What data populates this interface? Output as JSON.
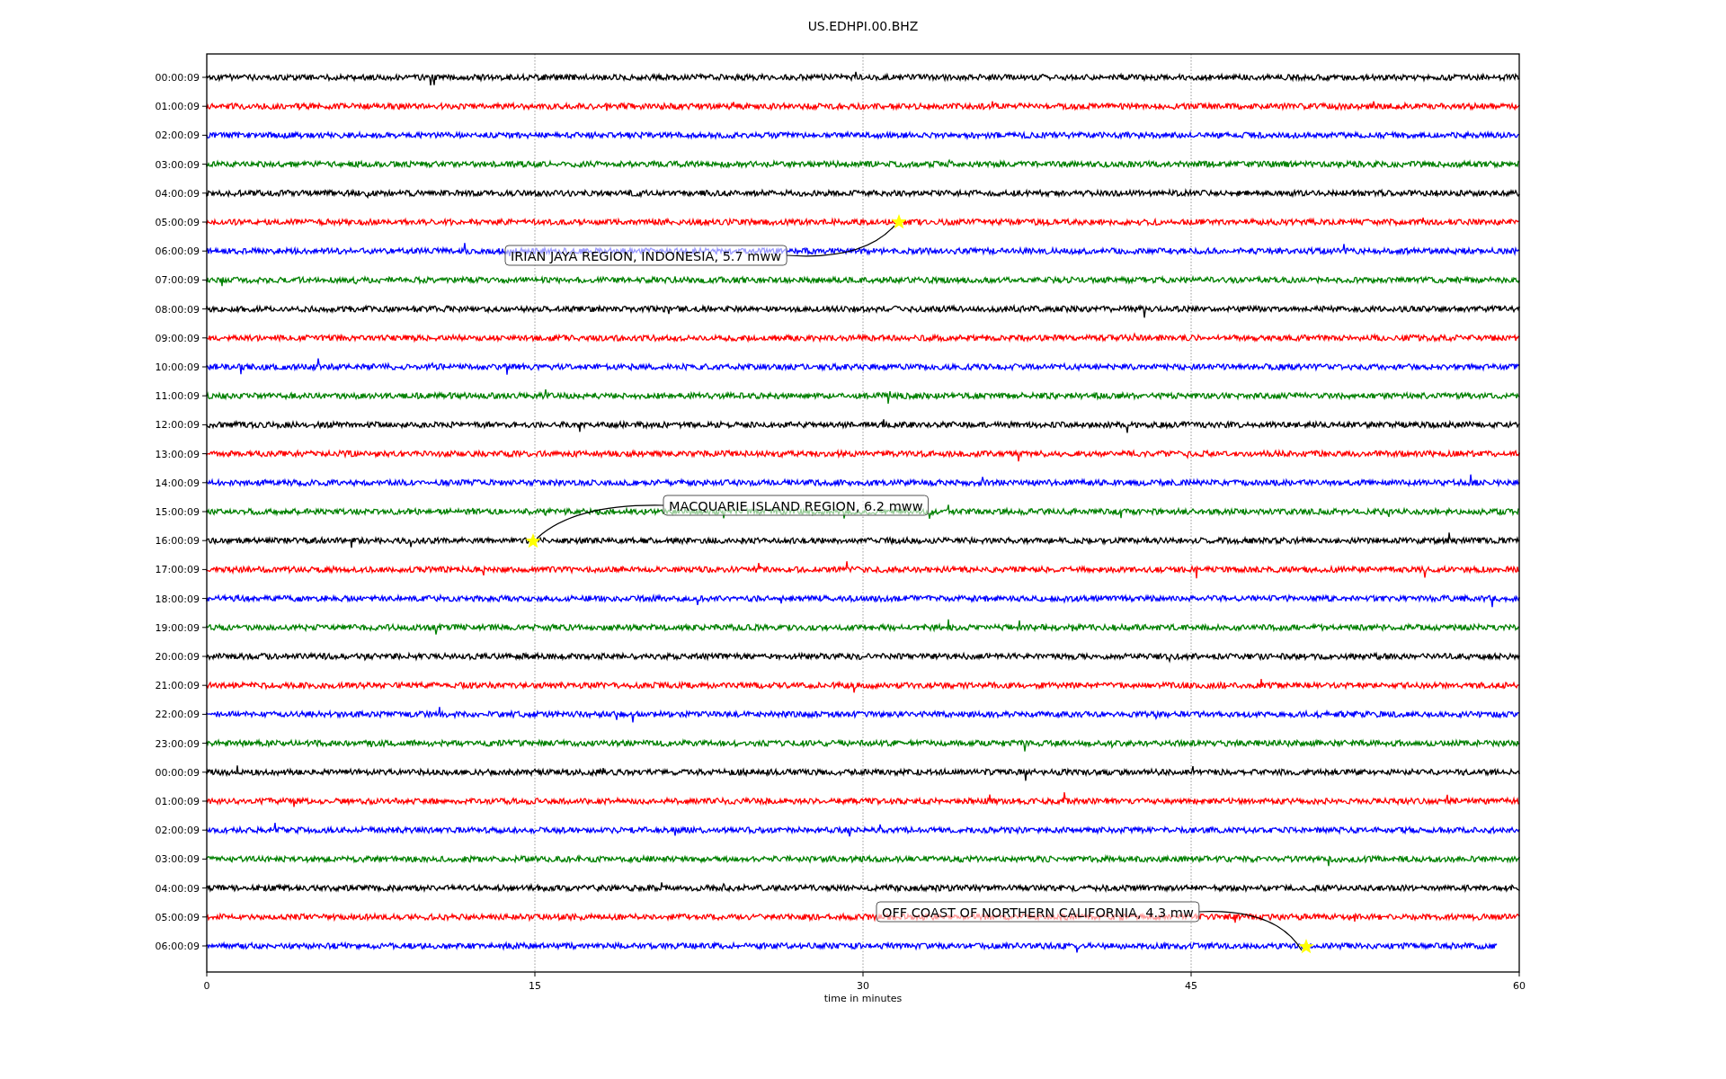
{
  "plot": {
    "title": "US.EDHPI.00.BHZ",
    "xlabel": "time in minutes",
    "xticks": [
      "0",
      "15",
      "30",
      "45",
      "60"
    ],
    "rows": [
      {
        "label": "00:00:09",
        "color": "#000000"
      },
      {
        "label": "01:00:09",
        "color": "#ff0000"
      },
      {
        "label": "02:00:09",
        "color": "#0000ff"
      },
      {
        "label": "03:00:09",
        "color": "#008000"
      },
      {
        "label": "04:00:09",
        "color": "#000000"
      },
      {
        "label": "05:00:09",
        "color": "#ff0000"
      },
      {
        "label": "06:00:09",
        "color": "#0000ff"
      },
      {
        "label": "07:00:09",
        "color": "#008000"
      },
      {
        "label": "08:00:09",
        "color": "#000000"
      },
      {
        "label": "09:00:09",
        "color": "#ff0000"
      },
      {
        "label": "10:00:09",
        "color": "#0000ff"
      },
      {
        "label": "11:00:09",
        "color": "#008000"
      },
      {
        "label": "12:00:09",
        "color": "#000000"
      },
      {
        "label": "13:00:09",
        "color": "#ff0000"
      },
      {
        "label": "14:00:09",
        "color": "#0000ff"
      },
      {
        "label": "15:00:09",
        "color": "#008000"
      },
      {
        "label": "16:00:09",
        "color": "#000000"
      },
      {
        "label": "17:00:09",
        "color": "#ff0000"
      },
      {
        "label": "18:00:09",
        "color": "#0000ff"
      },
      {
        "label": "19:00:09",
        "color": "#008000"
      },
      {
        "label": "20:00:09",
        "color": "#000000"
      },
      {
        "label": "21:00:09",
        "color": "#ff0000"
      },
      {
        "label": "22:00:09",
        "color": "#0000ff"
      },
      {
        "label": "23:00:09",
        "color": "#008000"
      },
      {
        "label": "00:00:09",
        "color": "#000000"
      },
      {
        "label": "01:00:09",
        "color": "#ff0000"
      },
      {
        "label": "02:00:09",
        "color": "#0000ff"
      },
      {
        "label": "03:00:09",
        "color": "#008000"
      },
      {
        "label": "04:00:09",
        "color": "#000000"
      },
      {
        "label": "05:00:09",
        "color": "#ff0000"
      },
      {
        "label": "06:00:09",
        "color": "#0000ff"
      }
    ],
    "events": [
      {
        "label": "IRIAN JAYA REGION, INDONESIA, 5.7 mww"
      },
      {
        "label": "MACQUARIE ISLAND REGION, 6.2 mww"
      },
      {
        "label": "OFF COAST OF NORTHERN CALIFORNIA, 4.3 mw"
      }
    ]
  }
}
